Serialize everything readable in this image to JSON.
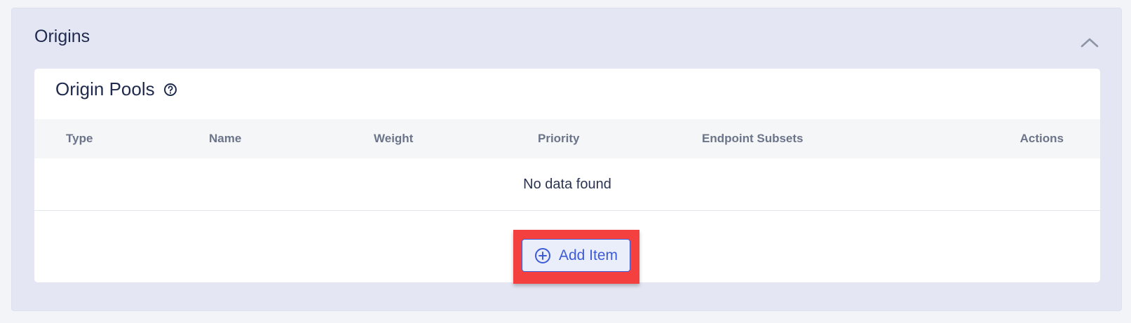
{
  "section": {
    "title": "Origins",
    "collapse_icon": "chevron-up-icon"
  },
  "card": {
    "title": "Origin Pools",
    "help_icon": "question-circle-icon"
  },
  "table": {
    "columns": [
      "Type",
      "Name",
      "Weight",
      "Priority",
      "Endpoint Subsets",
      "Actions"
    ],
    "empty_message": "No data found"
  },
  "add_button": {
    "label": "Add Item",
    "icon": "plus-circle-icon"
  },
  "colors": {
    "accent": "#3e5bd6",
    "highlight": "#f54040",
    "section_bg": "#e4e7f3"
  }
}
